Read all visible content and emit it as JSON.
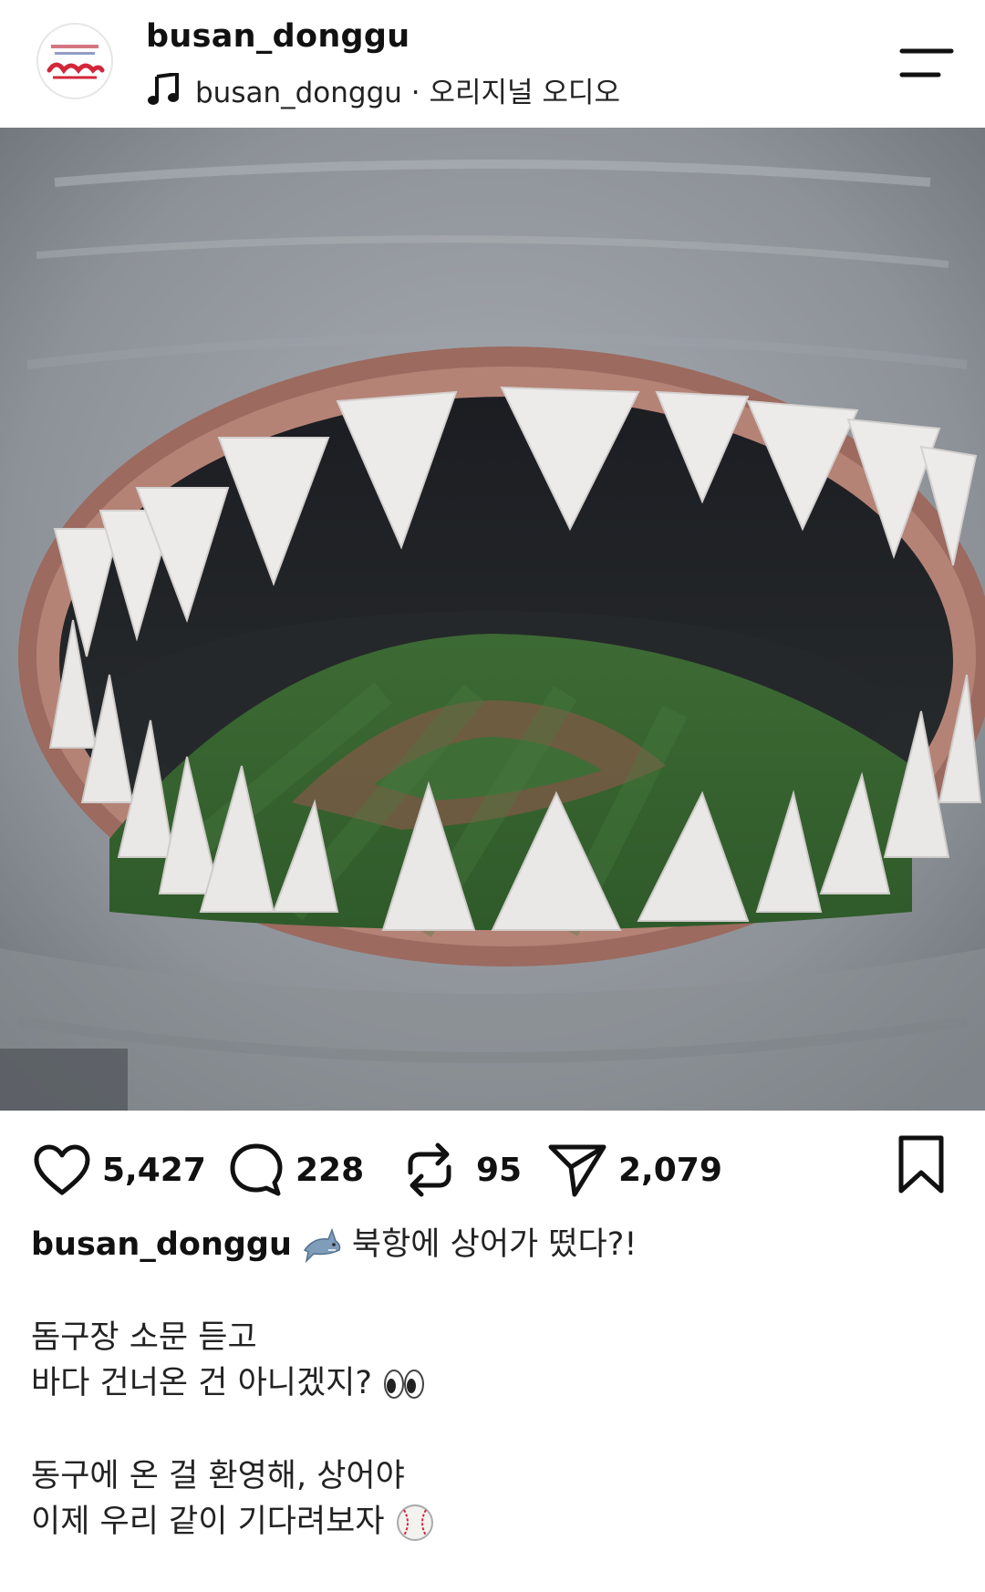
{
  "header": {
    "username": "busan_donggu",
    "audio_text": "busan_donggu · 오리지널 오디오",
    "avatar_icon": "donggu-logo-avatar",
    "menu_icon": "menu-icon"
  },
  "media": {
    "mute_icon": "speaker-muted-icon"
  },
  "actions": {
    "likes": "5,427",
    "comments": "228",
    "reposts": "95",
    "shares": "2,079"
  },
  "caption": {
    "username": "busan_donggu",
    "line1": "북항에 상어가 떴다?!",
    "line2": "돔구장 소문 듣고",
    "line3": "바다 건너온 건 아니겠지?",
    "line4": "동구에 온 걸 환영해, 상어야",
    "line5": "이제 우리 같이 기다려보자"
  },
  "colors": {
    "accent_red": "#d3263a",
    "text": "#111111",
    "background": "#ffffff"
  }
}
